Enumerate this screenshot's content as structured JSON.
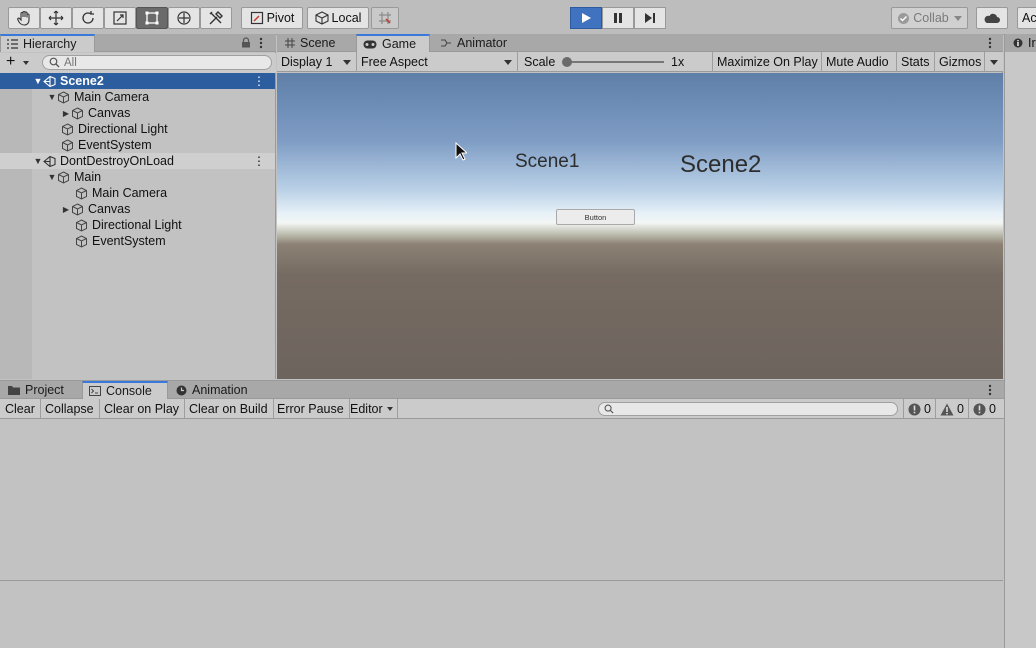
{
  "toolbar": {
    "tools": [
      "hand-tool",
      "move-tool",
      "rotate-tool",
      "scale-tool",
      "rect-tool",
      "transform-tool",
      "custom-tool"
    ],
    "pivot_label": "Pivot",
    "local_label": "Local",
    "collab_label": "Collab",
    "account_label": "Ac"
  },
  "hierarchy": {
    "tab_label": "Hierarchy",
    "search_placeholder": "All",
    "rows": [
      {
        "label": "Scene2",
        "type": "scene",
        "selected": true
      },
      {
        "label": "Main Camera"
      },
      {
        "label": "Canvas"
      },
      {
        "label": "Directional Light"
      },
      {
        "label": "EventSystem"
      },
      {
        "label": "DontDestroyOnLoad",
        "type": "scene"
      },
      {
        "label": "Main"
      },
      {
        "label": "Main Camera"
      },
      {
        "label": "Canvas"
      },
      {
        "label": "Directional Light"
      },
      {
        "label": "EventSystem"
      }
    ]
  },
  "game": {
    "tabs": [
      "Scene",
      "Game",
      "Animator"
    ],
    "display": "Display 1",
    "aspect": "Free Aspect",
    "scale_label": "Scale",
    "scale_value": "1x",
    "maximize": "Maximize On Play",
    "mute": "Mute Audio",
    "stats": "Stats",
    "gizmos": "Gizmos",
    "scene1_text": "Scene1",
    "scene2_text": "Scene2",
    "button_text": "Button"
  },
  "inspector": {
    "tab_label": "Ir"
  },
  "console": {
    "tabs": [
      "Project",
      "Console",
      "Animation"
    ],
    "buttons": [
      "Clear",
      "Collapse",
      "Clear on Play",
      "Clear on Build",
      "Error Pause",
      "Editor"
    ],
    "log_count": "0",
    "warning_count": "0",
    "error_count": "0"
  },
  "colors": {
    "accent": "#3a79d9",
    "selection": "#2c5d9e",
    "play_active": "#3f73c0"
  }
}
